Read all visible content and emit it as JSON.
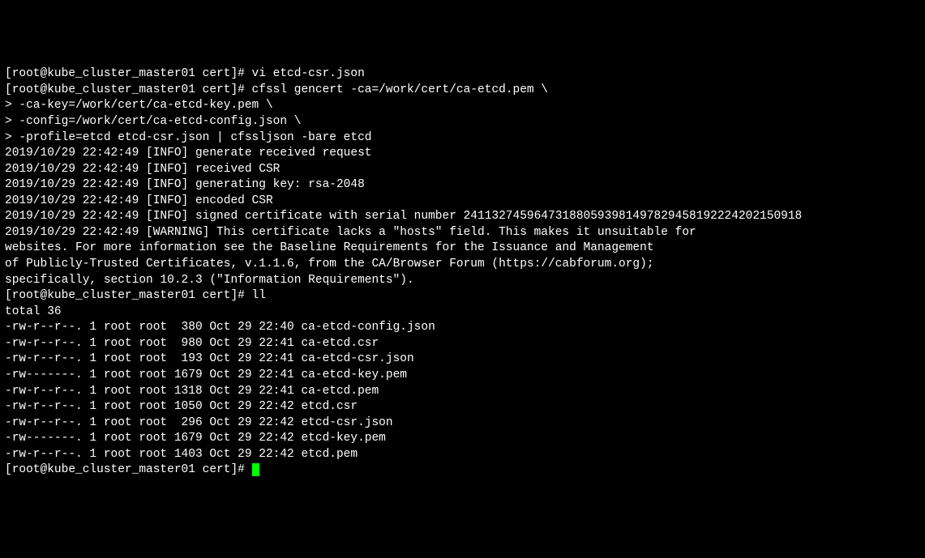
{
  "lines": [
    "[root@kube_cluster_master01 cert]# vi etcd-csr.json",
    "[root@kube_cluster_master01 cert]# cfssl gencert -ca=/work/cert/ca-etcd.pem \\",
    "> -ca-key=/work/cert/ca-etcd-key.pem \\",
    "> -config=/work/cert/ca-etcd-config.json \\",
    "> -profile=etcd etcd-csr.json | cfssljson -bare etcd",
    "2019/10/29 22:42:49 [INFO] generate received request",
    "2019/10/29 22:42:49 [INFO] received CSR",
    "2019/10/29 22:42:49 [INFO] generating key: rsa-2048",
    "2019/10/29 22:42:49 [INFO] encoded CSR",
    "2019/10/29 22:42:49 [INFO] signed certificate with serial number 241132745964731880593981497829458192224202150918",
    "2019/10/29 22:42:49 [WARNING] This certificate lacks a \"hosts\" field. This makes it unsuitable for",
    "websites. For more information see the Baseline Requirements for the Issuance and Management",
    "of Publicly-Trusted Certificates, v.1.1.6, from the CA/Browser Forum (https://cabforum.org);",
    "specifically, section 10.2.3 (\"Information Requirements\").",
    "[root@kube_cluster_master01 cert]# ll",
    "total 36",
    "-rw-r--r--. 1 root root  380 Oct 29 22:40 ca-etcd-config.json",
    "-rw-r--r--. 1 root root  980 Oct 29 22:41 ca-etcd.csr",
    "-rw-r--r--. 1 root root  193 Oct 29 22:41 ca-etcd-csr.json",
    "-rw-------. 1 root root 1679 Oct 29 22:41 ca-etcd-key.pem",
    "-rw-r--r--. 1 root root 1318 Oct 29 22:41 ca-etcd.pem",
    "-rw-r--r--. 1 root root 1050 Oct 29 22:42 etcd.csr",
    "-rw-r--r--. 1 root root  296 Oct 29 22:42 etcd-csr.json",
    "-rw-------. 1 root root 1679 Oct 29 22:42 etcd-key.pem",
    "-rw-r--r--. 1 root root 1403 Oct 29 22:42 etcd.pem"
  ],
  "prompt_final": "[root@kube_cluster_master01 cert]# "
}
